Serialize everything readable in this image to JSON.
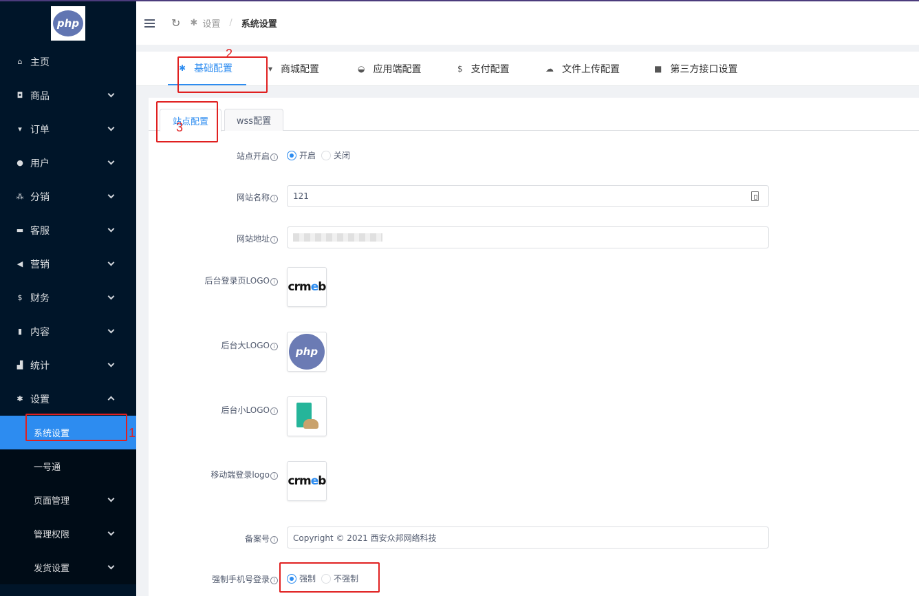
{
  "sidebar": {
    "logo_text": "php",
    "items": [
      {
        "icon": "home-icon",
        "glyph": "⌂",
        "label": "主页"
      },
      {
        "icon": "basket-icon",
        "glyph": "◘",
        "label": "商品"
      },
      {
        "icon": "cart-icon",
        "glyph": "▾",
        "label": "订单"
      },
      {
        "icon": "user-icon",
        "glyph": "●",
        "label": "用户"
      },
      {
        "icon": "group-icon",
        "glyph": "⁂",
        "label": "分销"
      },
      {
        "icon": "chat-icon",
        "glyph": "▬",
        "label": "客服"
      },
      {
        "icon": "send-icon",
        "glyph": "◀",
        "label": "营销"
      },
      {
        "icon": "dollar-icon",
        "glyph": "$",
        "label": "财务"
      },
      {
        "icon": "book-icon",
        "glyph": "▮",
        "label": "内容"
      },
      {
        "icon": "bar-chart-icon",
        "glyph": "▟",
        "label": "统计"
      },
      {
        "icon": "gear-icon",
        "glyph": "✱",
        "label": "设置"
      }
    ],
    "submenu": [
      {
        "label": "系统设置"
      },
      {
        "label": "一号通"
      },
      {
        "label": "页面管理"
      },
      {
        "label": "管理权限"
      },
      {
        "label": "发货设置"
      }
    ]
  },
  "header": {
    "breadcrumb_1": "设置",
    "breadcrumb_sep": "/",
    "breadcrumb_2": "系统设置"
  },
  "top_tabs": [
    {
      "icon": "gear-icon",
      "glyph": "✱",
      "label": "基础配置"
    },
    {
      "icon": "cart-icon",
      "glyph": "▾",
      "label": "商城配置"
    },
    {
      "icon": "dashboard-icon",
      "glyph": "◒",
      "label": "应用端配置"
    },
    {
      "icon": "dollar-icon",
      "glyph": "$",
      "label": "支付配置"
    },
    {
      "icon": "cloud-upload-icon",
      "glyph": "☁",
      "label": "文件上传配置"
    },
    {
      "icon": "briefcase-icon",
      "glyph": "■",
      "label": "第三方接口设置"
    }
  ],
  "sub_tabs": [
    "站点配置",
    "wss配置"
  ],
  "form": {
    "site_open_label": "站点开启",
    "site_open_options": [
      "开启",
      "关闭"
    ],
    "site_name_label": "网站名称",
    "site_name_value": "121",
    "site_url_label": "网站地址",
    "login_logo_label": "后台登录页LOGO",
    "big_logo_label": "后台大LOGO",
    "small_logo_label": "后台小LOGO",
    "mobile_logo_label": "移动端登录logo",
    "icp_label": "备案号",
    "icp_value": "Copyright © 2021 西安众邦网络科技",
    "force_phone_label": "强制手机号登录",
    "force_phone_options": [
      "强制",
      "不强制"
    ]
  },
  "logos": {
    "crmeb_pre": "crm",
    "crmeb_e": "e",
    "crmeb_post": "b",
    "php": "php"
  },
  "annotations": [
    "1",
    "2",
    "3"
  ],
  "info_glyph": "i"
}
